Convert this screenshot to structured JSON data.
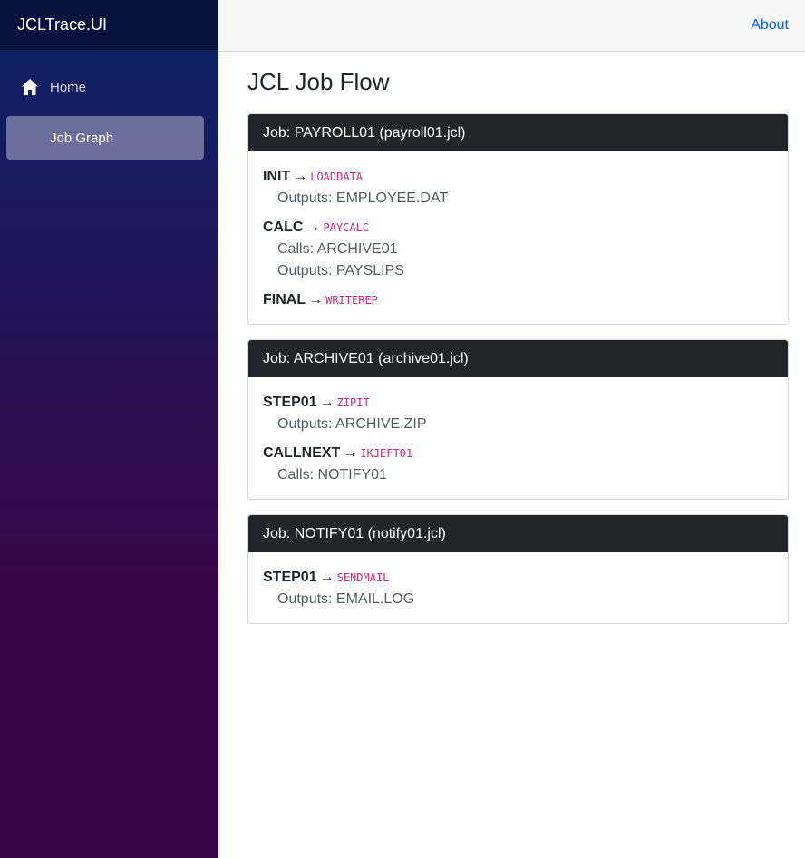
{
  "sidebar": {
    "brand": "JCLTrace.UI",
    "items": [
      {
        "label": "Home",
        "icon": "home-icon",
        "active": false
      },
      {
        "label": "Job Graph",
        "active": true
      }
    ]
  },
  "topbar": {
    "about_label": "About"
  },
  "main": {
    "title": "JCL Job Flow",
    "arrow": "→",
    "jobs": [
      {
        "header": "Job: PAYROLL01 (payroll01.jcl)",
        "steps": [
          {
            "name": "INIT",
            "program": "LOADDATA",
            "details": [
              "Outputs: EMPLOYEE.DAT"
            ]
          },
          {
            "name": "CALC",
            "program": "PAYCALC",
            "details": [
              "Calls: ARCHIVE01",
              "Outputs: PAYSLIPS"
            ]
          },
          {
            "name": "FINAL",
            "program": "WRITEREP",
            "details": []
          }
        ]
      },
      {
        "header": "Job: ARCHIVE01 (archive01.jcl)",
        "steps": [
          {
            "name": "STEP01",
            "program": "ZIPIT",
            "details": [
              "Outputs: ARCHIVE.ZIP"
            ]
          },
          {
            "name": "CALLNEXT",
            "program": "IKJEFT01",
            "details": [
              "Calls: NOTIFY01"
            ]
          }
        ]
      },
      {
        "header": "Job: NOTIFY01 (notify01.jcl)",
        "steps": [
          {
            "name": "STEP01",
            "program": "SENDMAIL",
            "details": [
              "Outputs: EMAIL.LOG"
            ]
          }
        ]
      }
    ]
  },
  "colors": {
    "sidebar_top": "#0a2267",
    "sidebar_bottom": "#3a0647",
    "link": "#0366d6",
    "code": "#c5307a",
    "card_header": "#212529"
  }
}
